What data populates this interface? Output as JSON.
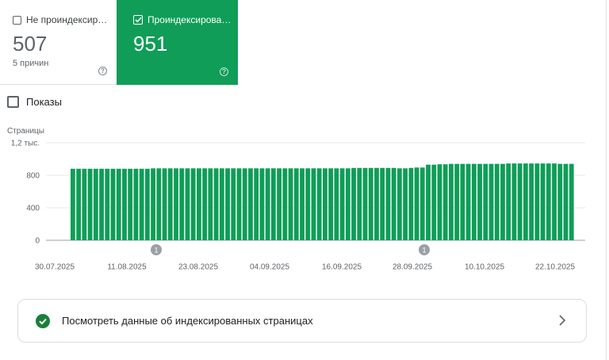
{
  "tiles": {
    "not_indexed": {
      "label": "Не проиндексир…",
      "value": "507",
      "sub": "5 причин",
      "help_icon": "help-circle-icon"
    },
    "indexed": {
      "label": "Проиндексирова…",
      "value": "951",
      "help_icon": "help-circle-icon"
    }
  },
  "impressions_toggle": {
    "label": "Показы",
    "checked": false
  },
  "colors": {
    "accent": "#0f9d58",
    "bar": "#0f9d58",
    "success_icon": "#188038"
  },
  "chart_data": {
    "type": "bar",
    "ylabel": "Страницы",
    "ylim": [
      0,
      1200
    ],
    "y_ticks": [
      "0",
      "400",
      "800",
      "1,2 тыс."
    ],
    "y_tick_values": [
      0,
      400,
      800,
      1200
    ],
    "x_tick_labels": [
      "30.07.2025",
      "11.08.2025",
      "23.08.2025",
      "04.09.2025",
      "16.09.2025",
      "28.09.2025",
      "10.10.2025",
      "22.10.2025"
    ],
    "annotations": [
      {
        "label": "1",
        "x": "14.08.2025"
      },
      {
        "label": "1",
        "x": "28.09.2025"
      }
    ],
    "x_start": "05.08.2025",
    "x_end": "22.10.2025",
    "values": [
      880,
      880,
      880,
      880,
      880,
      880,
      880,
      880,
      880,
      880,
      880,
      880,
      880,
      880,
      885,
      885,
      885,
      885,
      885,
      885,
      885,
      885,
      885,
      885,
      885,
      885,
      885,
      885,
      885,
      885,
      885,
      885,
      885,
      885,
      885,
      885,
      885,
      885,
      885,
      885,
      885,
      885,
      885,
      885,
      885,
      885,
      885,
      885,
      885,
      890,
      890,
      890,
      890,
      890,
      890,
      890,
      890,
      885,
      885,
      890,
      895,
      895,
      930,
      930,
      935,
      935,
      940,
      940,
      940,
      940,
      940,
      940,
      940,
      940,
      940,
      940,
      945,
      945,
      945,
      945,
      945,
      945,
      945,
      945,
      945,
      940,
      940,
      940
    ]
  },
  "footer_card": {
    "label": "Посмотреть данные об индексированных страницах",
    "icon": "check-circle-icon",
    "chevron": "chevron-right-icon"
  }
}
